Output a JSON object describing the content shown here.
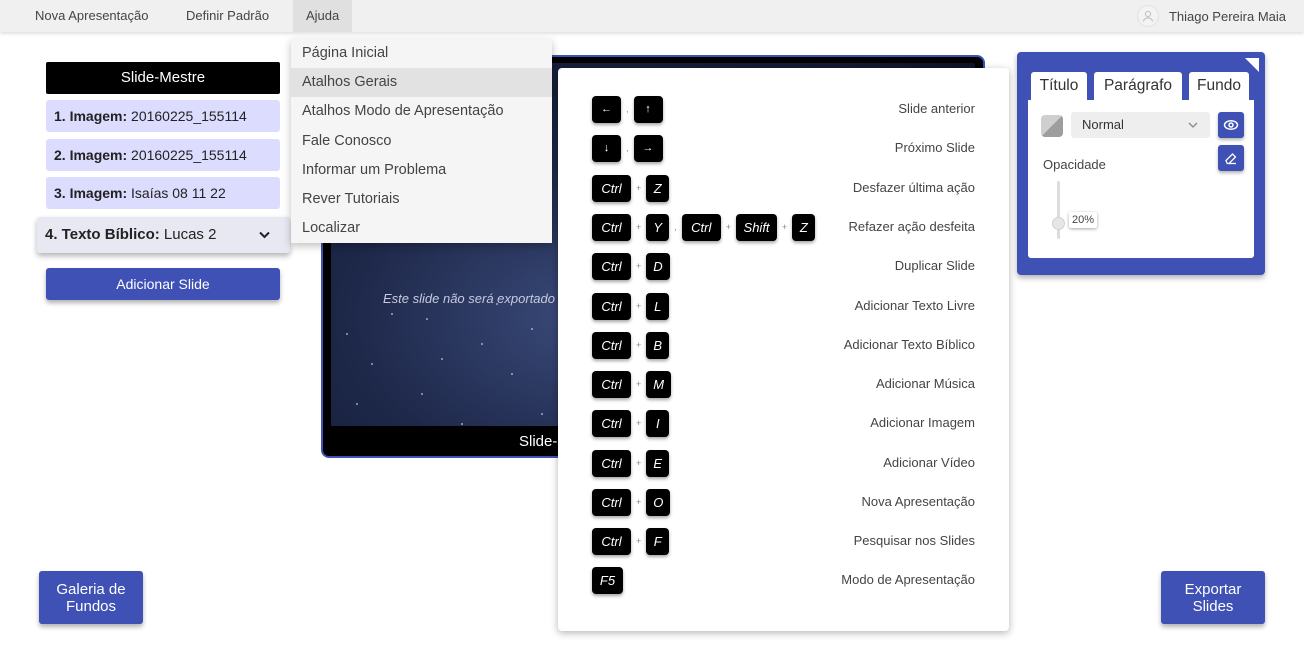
{
  "menu": {
    "items": [
      "Nova Apresentação",
      "Definir Padrão",
      "Ajuda"
    ],
    "user_name": "Thiago Pereira Maia"
  },
  "slides": {
    "master_label": "Slide-Mestre",
    "items": [
      {
        "label": "1. Imagem:",
        "value": "20160225_155114"
      },
      {
        "label": "2. Imagem:",
        "value": "20160225_155114"
      },
      {
        "label": "3. Imagem:",
        "value": "Isaías 08 11 22"
      },
      {
        "label": "4. Texto Bíblico:",
        "value": "Lucas 2"
      }
    ],
    "add_label": "Adicionar Slide"
  },
  "preview": {
    "note": "Este slide não será exportado",
    "label": "Slide-"
  },
  "help_menu": {
    "items": [
      "Página Inicial",
      "Atalhos Gerais",
      "Atalhos Modo de Apresentação",
      "Fale Conosco",
      "Informar um Problema",
      "Rever Tutoriais",
      "Localizar"
    ]
  },
  "shortcuts": [
    {
      "keys": "←  ,  ↑",
      "desc": "Slide anterior"
    },
    {
      "keys": "↓  ,  →",
      "desc": "Próximo Slide"
    },
    {
      "keys": "Ctrl + Z",
      "desc": "Desfazer última ação"
    },
    {
      "keys": "Ctrl + Y , Ctrl + Shift + Z",
      "desc": "Refazer ação desfeita"
    },
    {
      "keys": "Ctrl + D",
      "desc": "Duplicar Slide"
    },
    {
      "keys": "Ctrl + L",
      "desc": "Adicionar Texto Livre"
    },
    {
      "keys": "Ctrl + B",
      "desc": "Adicionar Texto Bíblico"
    },
    {
      "keys": "Ctrl + M",
      "desc": "Adicionar Música"
    },
    {
      "keys": "Ctrl + I",
      "desc": "Adicionar Imagem"
    },
    {
      "keys": "Ctrl + E",
      "desc": "Adicionar Vídeo"
    },
    {
      "keys": "Ctrl + O",
      "desc": "Nova Apresentação"
    },
    {
      "keys": "Ctrl + F",
      "desc": "Pesquisar nos Slides"
    },
    {
      "keys": "F5",
      "desc": "Modo de Apresentação"
    }
  ],
  "key_labels": {
    "ctrl": "Ctrl",
    "shift": "Shift",
    "plus": "+",
    "comma": ",",
    "left": "←",
    "up": "↑",
    "down": "↓",
    "right": "→",
    "z": "Z",
    "y": "Y",
    "d": "D",
    "l": "L",
    "b": "B",
    "m": "M",
    "i": "I",
    "e": "E",
    "o": "O",
    "f": "F",
    "f5": "F5"
  },
  "props": {
    "tabs": [
      "Título",
      "Parágrafo",
      "Fundo"
    ],
    "active_tab": "Fundo",
    "blend_mode": "Normal",
    "opacity_label": "Opacidade",
    "opacity_value": "20%",
    "opacity_level": 0.2
  },
  "bottom": {
    "gallery_line1": "Galeria de",
    "gallery_line2": "Fundos",
    "export_line1": "Exportar",
    "export_line2": "Slides"
  },
  "colors": {
    "accent": "#3f51b5",
    "slide_item_bg": "#dcdcff",
    "menubar_bg": "#f0f0f0"
  }
}
